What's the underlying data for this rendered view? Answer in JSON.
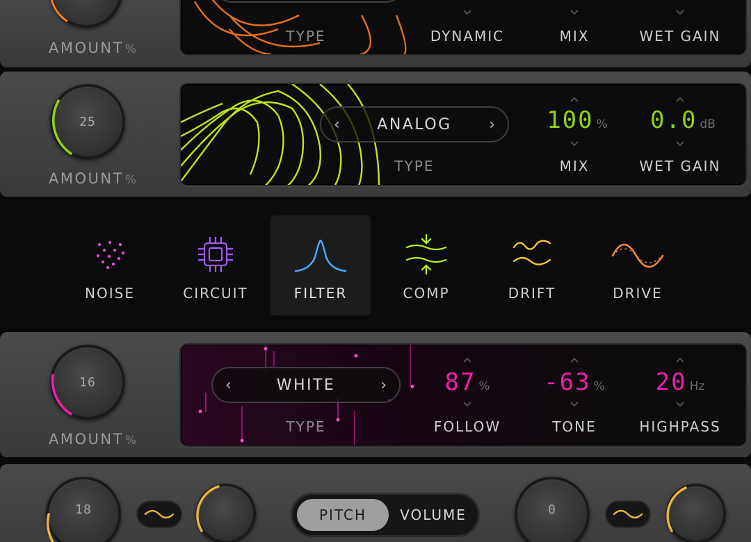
{
  "top_panel": {
    "amount_label": "AMOUNT",
    "amount_unit": "%",
    "type_label": "TYPE",
    "params": [
      {
        "label": "DYNAMIC"
      },
      {
        "label": "MIX"
      },
      {
        "label": "WET GAIN"
      }
    ],
    "accent": "#ff7a1a"
  },
  "analog_panel": {
    "knob_value": "25",
    "amount_label": "AMOUNT",
    "amount_unit": "%",
    "type_value": "ANALOG",
    "type_label": "TYPE",
    "prev_arrow": "‹",
    "next_arrow": "›",
    "params": [
      {
        "label": "MIX",
        "value": "100",
        "unit": "%"
      },
      {
        "label": "WET GAIN",
        "value": "0.0",
        "unit": "dB"
      }
    ],
    "accent": "#8fd21a"
  },
  "modules": {
    "items": [
      {
        "label": "NOISE",
        "icon": "noise-dots-icon",
        "color": "#d64fd0"
      },
      {
        "label": "CIRCUIT",
        "icon": "chip-icon",
        "color": "#a05bff"
      },
      {
        "label": "FILTER",
        "icon": "bell-curve-icon",
        "color": "#4aa8ff",
        "active": true
      },
      {
        "label": "COMP",
        "icon": "compress-arrows-icon",
        "color": "#b6f21c"
      },
      {
        "label": "DRIFT",
        "icon": "drift-waves-icon",
        "color": "#ffcc33"
      },
      {
        "label": "DRIVE",
        "icon": "sine-wave-icon",
        "color": "#ff8a3d"
      }
    ]
  },
  "noise_panel": {
    "knob_value": "16",
    "amount_label": "AMOUNT",
    "amount_unit": "%",
    "type_value": "WHITE",
    "type_label": "TYPE",
    "prev_arrow": "‹",
    "next_arrow": "›",
    "params": [
      {
        "label": "FOLLOW",
        "value": "87",
        "unit": "%"
      },
      {
        "label": "TONE",
        "value": "-63",
        "unit": "%"
      },
      {
        "label": "HIGHPASS",
        "value": "20",
        "unit": "Hz"
      }
    ],
    "accent": "#ef1fb1"
  },
  "bottom_panel": {
    "left_knob_value": "18",
    "right_knob_value": "0",
    "toggle_on": "PITCH",
    "toggle_off": "VOLUME",
    "accent": "#e8b53a"
  }
}
